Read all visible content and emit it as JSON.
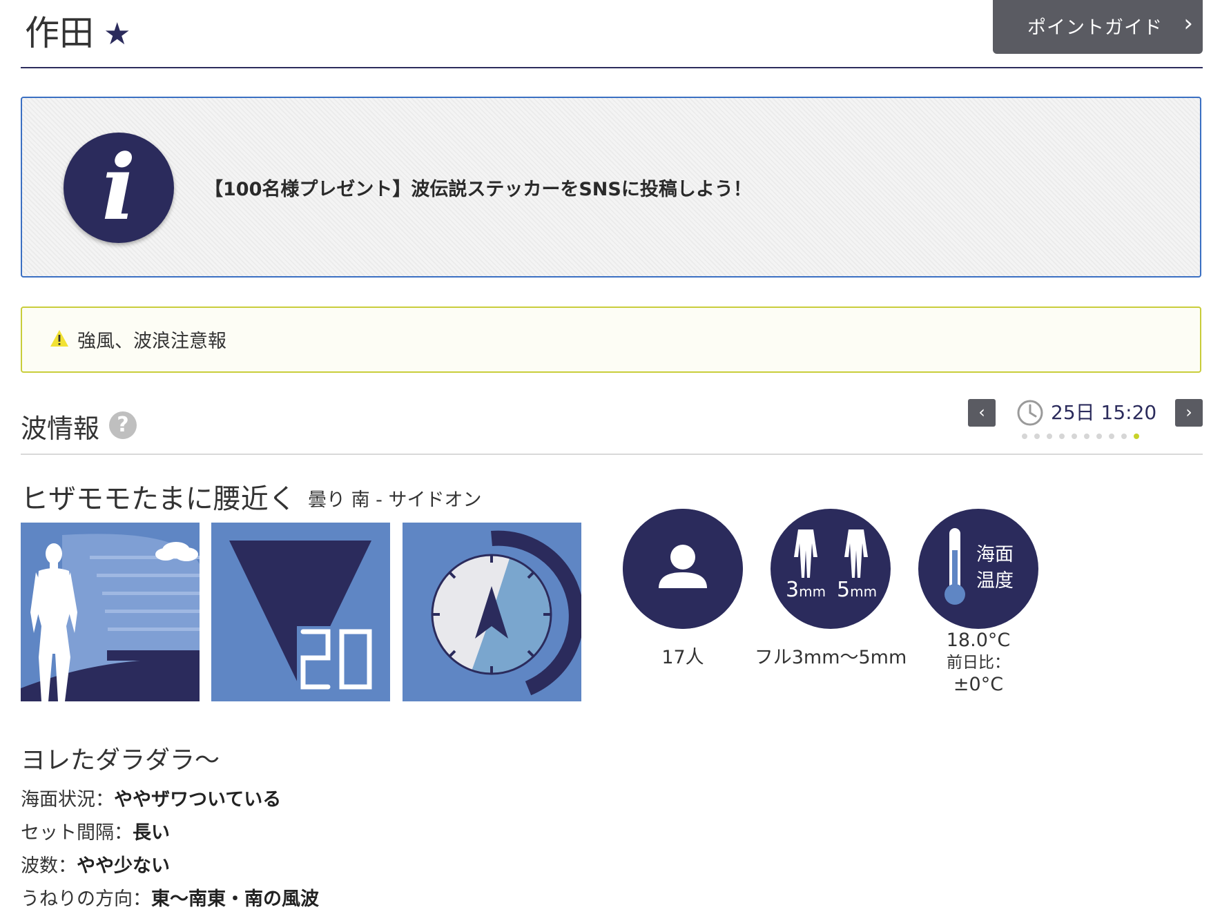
{
  "header": {
    "spot_name": "作田",
    "favorite_star": "★",
    "guide_button": "ポイントガイド",
    "guide_chevron": "›"
  },
  "info_banner": {
    "icon_letter": "i",
    "text": "【100名様プレゼント】波伝説ステッカーをSNSに投稿しよう！"
  },
  "warning_banner": {
    "text": "強風、波浪注意報"
  },
  "wave_info": {
    "heading": "波情報",
    "help_icon": "?",
    "time_nav": {
      "prev": "‹",
      "next": "›",
      "time": "25日 15:20",
      "dots_total": 10,
      "dots_active_index": 9
    },
    "condition": "ヒザモモたまに腰近く",
    "condition_details": "曇り 南 - サイドオン",
    "tiles": {
      "period_value": "20"
    },
    "people": {
      "caption": "17人"
    },
    "wetsuit": {
      "label_3": "3",
      "label_5": "5",
      "unit": "mm",
      "caption": "フル3mm〜5mm"
    },
    "sea_temp": {
      "icon_label_1": "海面",
      "icon_label_2": "温度",
      "value": "18.0°C",
      "compare_label": "前日比：",
      "compare_value": "±0°C"
    }
  },
  "surf_report": {
    "comment": "ヨレたダラダラ〜",
    "rows": [
      {
        "label": "海面状況：",
        "value": "ややザワついている"
      },
      {
        "label": "セット間隔：",
        "value": "長い"
      },
      {
        "label": "波数：",
        "value": "やや少ない"
      },
      {
        "label": "うねりの方向：",
        "value": "東〜南東・南の風波"
      }
    ]
  },
  "colors": {
    "navy": "#2b2b5c",
    "tile_blue": "#5f86c4",
    "button_gray": "#5a5b62",
    "info_border": "#3a6fc2",
    "warning_border": "#c9cd3a",
    "active_dot": "#c8d22a"
  }
}
